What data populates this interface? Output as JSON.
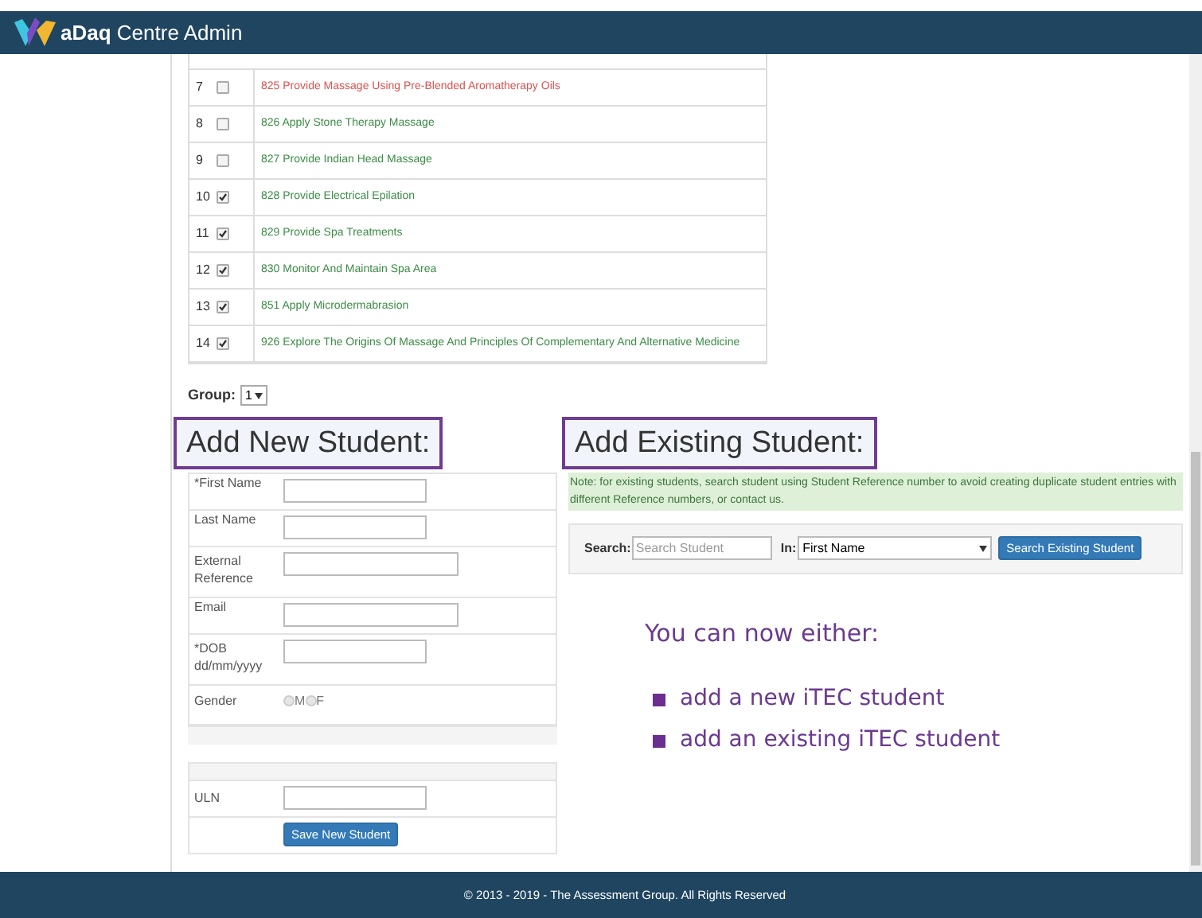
{
  "header": {
    "title": "**aDaq** Centre Admin"
  },
  "units": [
    {
      "number": "7",
      "checked": false,
      "title": "825 Provide Massage Using Pre-Blended Aromatherapy Oils",
      "color": "#d9534f"
    },
    {
      "number": "8",
      "checked": false,
      "title": "826 Apply Stone Therapy Massage",
      "color": "#3c8c46"
    },
    {
      "number": "9",
      "checked": false,
      "title": "827 Provide Indian Head Massage",
      "color": "#3c8c46"
    },
    {
      "number": "10",
      "checked": true,
      "title": "828 Provide Electrical Epilation",
      "color": "#3c8c46"
    },
    {
      "number": "11",
      "checked": true,
      "title": "829 Provide Spa Treatments",
      "color": "#3c8c46"
    },
    {
      "number": "12",
      "checked": true,
      "title": "830 Monitor And Maintain Spa Area",
      "color": "#3c8c46"
    },
    {
      "number": "13",
      "checked": true,
      "title": "851 Apply Microdermabrasion",
      "color": "#3c8c46"
    },
    {
      "number": "14",
      "checked": true,
      "title": "926 Explore The Origins Of Massage And Principles Of Complementary And Alternative Medicine",
      "color": "#3c8c46"
    }
  ],
  "group": {
    "label": "Group:",
    "value": "1"
  },
  "new_student": {
    "heading": "Add New Student:",
    "fields": [
      {
        "label": "*First Name",
        "kind": "short"
      },
      {
        "label": "Last Name",
        "kind": "short"
      },
      {
        "label": "External Reference",
        "kind": "long"
      },
      {
        "label": "Email",
        "kind": "long"
      },
      {
        "label": "*DOB dd/mm/yyyy",
        "kind": "short"
      },
      {
        "label": "Gender",
        "kind": "radio",
        "options": [
          {
            "label": "M",
            "selected": false
          },
          {
            "label": "F",
            "selected": false
          }
        ]
      }
    ],
    "uln": {
      "label": "ULN"
    },
    "save_button": "Save New Student"
  },
  "existing_student": {
    "heading": "Add Existing Student:",
    "note": "Note: for existing students, search student using Student Reference number to avoid creating duplicate student entries with different Reference numbers, or contact us.",
    "search_label": "Search:",
    "search_placeholder": "Search Student",
    "in_label": "In:",
    "in_value": "First Name",
    "search_button": "Search Existing Student"
  },
  "info": {
    "title": "You can now either:",
    "items": [
      "add a new iTEC student",
      "add an existing iTEC student"
    ]
  },
  "footer": "© 2013 - 2019 - The Assessment Group. All Rights Reserved"
}
